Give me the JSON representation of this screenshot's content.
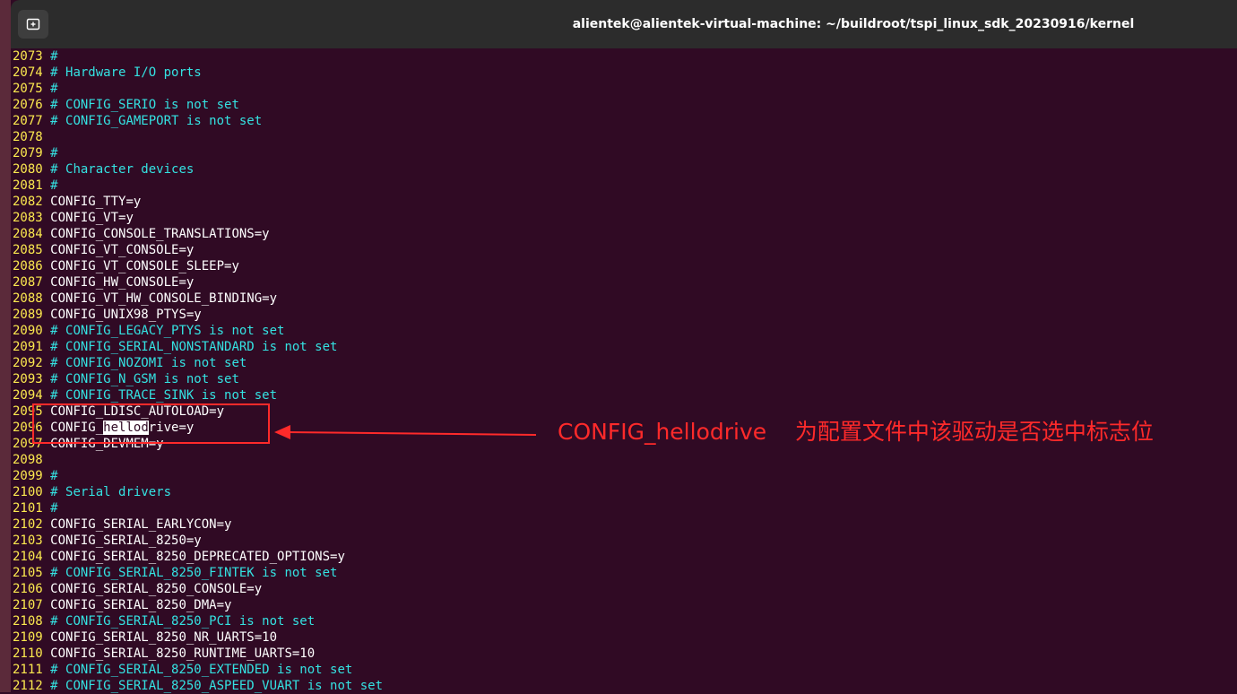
{
  "window": {
    "title": "alientek@alientek-virtual-machine: ~/buildroot/tspi_linux_sdk_20230916/kernel",
    "new_tab_icon": "new-tab-icon"
  },
  "editor": {
    "lines": [
      {
        "num": "2073",
        "text": "#",
        "kind": "comment"
      },
      {
        "num": "2074",
        "text": "# Hardware I/O ports",
        "kind": "comment"
      },
      {
        "num": "2075",
        "text": "#",
        "kind": "comment"
      },
      {
        "num": "2076",
        "text": "# CONFIG_SERIO is not set",
        "kind": "comment"
      },
      {
        "num": "2077",
        "text": "# CONFIG_GAMEPORT is not set",
        "kind": "comment"
      },
      {
        "num": "2078",
        "text": "",
        "kind": "normal"
      },
      {
        "num": "2079",
        "text": "#",
        "kind": "comment"
      },
      {
        "num": "2080",
        "text": "# Character devices",
        "kind": "comment"
      },
      {
        "num": "2081",
        "text": "#",
        "kind": "comment"
      },
      {
        "num": "2082",
        "text": "CONFIG_TTY=y",
        "kind": "normal"
      },
      {
        "num": "2083",
        "text": "CONFIG_VT=y",
        "kind": "normal"
      },
      {
        "num": "2084",
        "text": "CONFIG_CONSOLE_TRANSLATIONS=y",
        "kind": "normal"
      },
      {
        "num": "2085",
        "text": "CONFIG_VT_CONSOLE=y",
        "kind": "normal"
      },
      {
        "num": "2086",
        "text": "CONFIG_VT_CONSOLE_SLEEP=y",
        "kind": "normal"
      },
      {
        "num": "2087",
        "text": "CONFIG_HW_CONSOLE=y",
        "kind": "normal"
      },
      {
        "num": "2088",
        "text": "CONFIG_VT_HW_CONSOLE_BINDING=y",
        "kind": "normal"
      },
      {
        "num": "2089",
        "text": "CONFIG_UNIX98_PTYS=y",
        "kind": "normal"
      },
      {
        "num": "2090",
        "text": "# CONFIG_LEGACY_PTYS is not set",
        "kind": "comment"
      },
      {
        "num": "2091",
        "text": "# CONFIG_SERIAL_NONSTANDARD is not set",
        "kind": "comment"
      },
      {
        "num": "2092",
        "text": "# CONFIG_NOZOMI is not set",
        "kind": "comment"
      },
      {
        "num": "2093",
        "text": "# CONFIG_N_GSM is not set",
        "kind": "comment"
      },
      {
        "num": "2094",
        "text": "# CONFIG_TRACE_SINK is not set",
        "kind": "comment"
      },
      {
        "num": "2095",
        "text": "CONFIG_LDISC_AUTOLOAD=y",
        "kind": "normal"
      },
      {
        "num": "2096",
        "text": "CONFIG_hellodrive=y",
        "kind": "normal",
        "pre": "CONFIG_",
        "highlight": "hellod",
        "post": "rive=y"
      },
      {
        "num": "2097",
        "text": "CONFIG_DEVMEM=y",
        "kind": "normal"
      },
      {
        "num": "2098",
        "text": "",
        "kind": "normal"
      },
      {
        "num": "2099",
        "text": "#",
        "kind": "comment"
      },
      {
        "num": "2100",
        "text": "# Serial drivers",
        "kind": "comment"
      },
      {
        "num": "2101",
        "text": "#",
        "kind": "comment"
      },
      {
        "num": "2102",
        "text": "CONFIG_SERIAL_EARLYCON=y",
        "kind": "normal"
      },
      {
        "num": "2103",
        "text": "CONFIG_SERIAL_8250=y",
        "kind": "normal"
      },
      {
        "num": "2104",
        "text": "CONFIG_SERIAL_8250_DEPRECATED_OPTIONS=y",
        "kind": "normal"
      },
      {
        "num": "2105",
        "text": "# CONFIG_SERIAL_8250_FINTEK is not set",
        "kind": "comment"
      },
      {
        "num": "2106",
        "text": "CONFIG_SERIAL_8250_CONSOLE=y",
        "kind": "normal"
      },
      {
        "num": "2107",
        "text": "CONFIG_SERIAL_8250_DMA=y",
        "kind": "normal"
      },
      {
        "num": "2108",
        "text": "# CONFIG_SERIAL_8250_PCI is not set",
        "kind": "comment"
      },
      {
        "num": "2109",
        "text": "CONFIG_SERIAL_8250_NR_UARTS=10",
        "kind": "normal"
      },
      {
        "num": "2110",
        "text": "CONFIG_SERIAL_8250_RUNTIME_UARTS=10",
        "kind": "normal"
      },
      {
        "num": "2111",
        "text": "# CONFIG_SERIAL_8250_EXTENDED is not set",
        "kind": "comment"
      },
      {
        "num": "2112",
        "text": "# CONFIG_SERIAL_8250_ASPEED_VUART is not set",
        "kind": "comment"
      }
    ]
  },
  "annotation": {
    "text": "CONFIG_hellodrive    为配置文件中该驱动是否选中标志位",
    "color": "#ff2a2a"
  },
  "colors": {
    "background": "#300a24",
    "line_number": "#fce94f",
    "comment": "#34e2e2",
    "text": "#ffffff",
    "titlebar": "#2c2c2c"
  }
}
